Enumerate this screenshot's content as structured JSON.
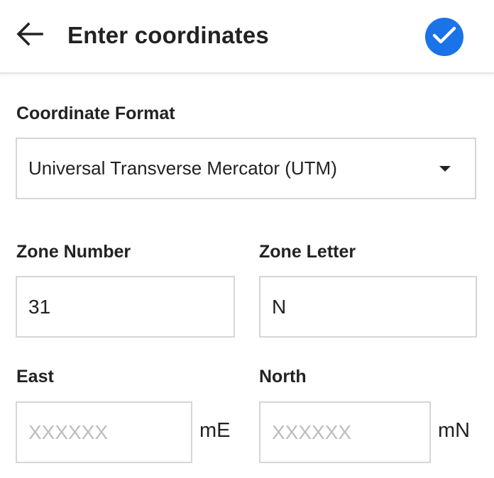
{
  "header": {
    "title": "Enter coordinates",
    "back_icon": "arrow-left-icon",
    "confirm_icon": "check-circle-icon",
    "accent_color": "#1a73e8"
  },
  "format": {
    "label": "Coordinate Format",
    "selected": "Universal Transverse Mercator (UTM)"
  },
  "zone_number": {
    "label": "Zone Number",
    "value": "31"
  },
  "zone_letter": {
    "label": "Zone Letter",
    "value": "N"
  },
  "east": {
    "label": "East",
    "placeholder": "XXXXXX",
    "value": "",
    "unit": "mE"
  },
  "north": {
    "label": "North",
    "placeholder": "XXXXXX",
    "value": "",
    "unit": "mN"
  }
}
